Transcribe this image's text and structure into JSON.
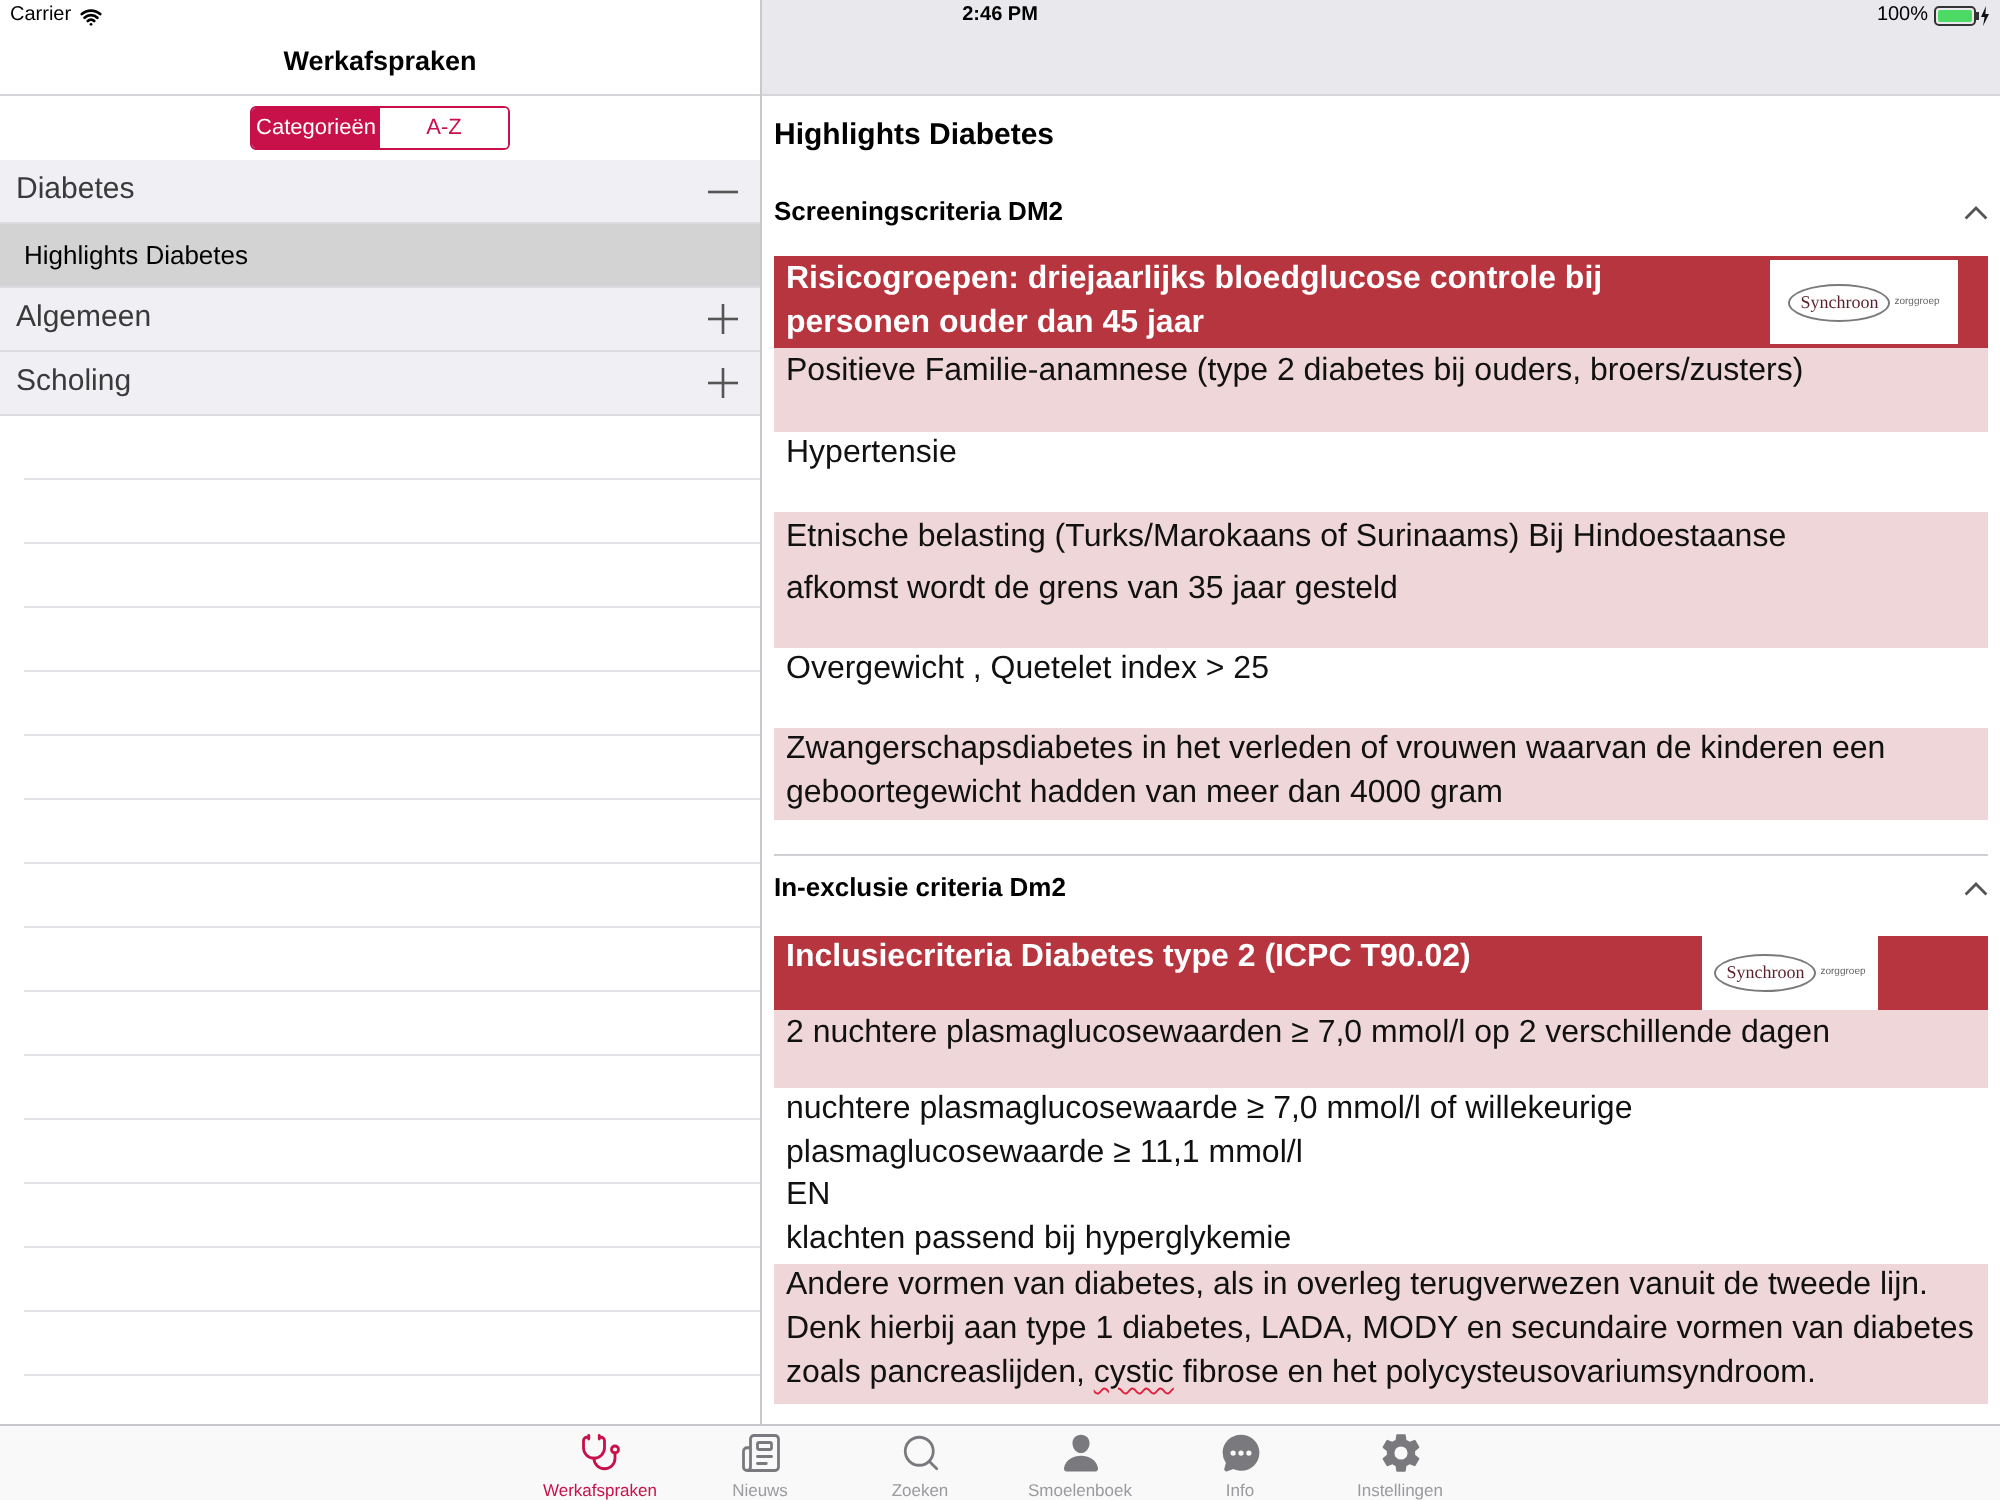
{
  "status_bar": {
    "carrier": "Carrier",
    "time": "2:46 PM",
    "battery": "100%"
  },
  "sidebar": {
    "title": "Werkafspraken",
    "segments": [
      {
        "label": "Categorieën",
        "selected": true
      },
      {
        "label": "A-Z",
        "selected": false
      }
    ],
    "groups": [
      {
        "label": "Diabetes",
        "expanded": true,
        "children": [
          {
            "label": "Highlights Diabetes",
            "selected": true
          }
        ]
      },
      {
        "label": "Algemeen",
        "expanded": false
      },
      {
        "label": "Scholing",
        "expanded": false
      }
    ]
  },
  "content": {
    "title": "Highlights Diabetes",
    "sections": [
      {
        "title": "Screeningscriteria DM2",
        "expanded": true,
        "slide": {
          "logo": {
            "name": "Synchroon",
            "tagline": "zorggroep"
          },
          "rows": [
            {
              "kind": "header",
              "text": "Risicogroepen: driejaarlijks bloedglucose controle bij\npersonen ouder dan 45 jaar"
            },
            {
              "kind": "shaded",
              "text": "Positieve Familie-anamnese (type 2 diabetes bij ouders, broers/zusters)"
            },
            {
              "kind": "plain",
              "text": "Hypertensie"
            },
            {
              "kind": "shaded",
              "text": "Etnische belasting (Turks/Marokaans of Surinaams) Bij Hindoestaanse\nafkomst wordt de grens van 35 jaar gesteld"
            },
            {
              "kind": "plain",
              "text": "Overgewicht , Quetelet index > 25"
            },
            {
              "kind": "shaded",
              "text": "Zwangerschapsdiabetes in het verleden of vrouwen waarvan de kinderen een\ngeboortegewicht hadden van meer dan 4000 gram"
            }
          ]
        }
      },
      {
        "title": "In-exclusie criteria Dm2",
        "expanded": true,
        "slide": {
          "logo": {
            "name": "Synchroon",
            "tagline": "zorggroep"
          },
          "rows": [
            {
              "kind": "header",
              "text": "Inclusiecriteria Diabetes type 2 (ICPC T90.02)"
            },
            {
              "kind": "shaded",
              "text": "2 nuchtere plasmaglucosewaarden ≥ 7,0 mmol/l op 2 verschillende dagen"
            },
            {
              "kind": "plain",
              "text": "nuchtere plasmaglucosewaarde ≥ 7,0 mmol/l of willekeurige\nplasmaglucosewaarde ≥ 11,1 mmol/l\nEN\nklachten passend bij hyperglykemie"
            },
            {
              "kind": "shaded",
              "segments": [
                {
                  "text": "Andere vormen van diabetes, als in overleg terugverwezen vanuit de tweede lijn.\nDenk hierbij aan type 1 diabetes, LADA, MODY en secundaire vormen van diabetes\nzoals pancreaslijden, ",
                  "flagged": false
                },
                {
                  "text": "cystic",
                  "flagged": true
                },
                {
                  "text": " fibrose en het polycysteusovariumsyndroom.",
                  "flagged": false
                }
              ]
            }
          ]
        }
      }
    ]
  },
  "tab_bar": [
    {
      "label": "Werkafspraken",
      "selected": true
    },
    {
      "label": "Nieuws",
      "selected": false
    },
    {
      "label": "Zoeken",
      "selected": false
    },
    {
      "label": "Smoelenboek",
      "selected": false
    },
    {
      "label": "Info",
      "selected": false
    },
    {
      "label": "Instellingen",
      "selected": false
    }
  ]
}
